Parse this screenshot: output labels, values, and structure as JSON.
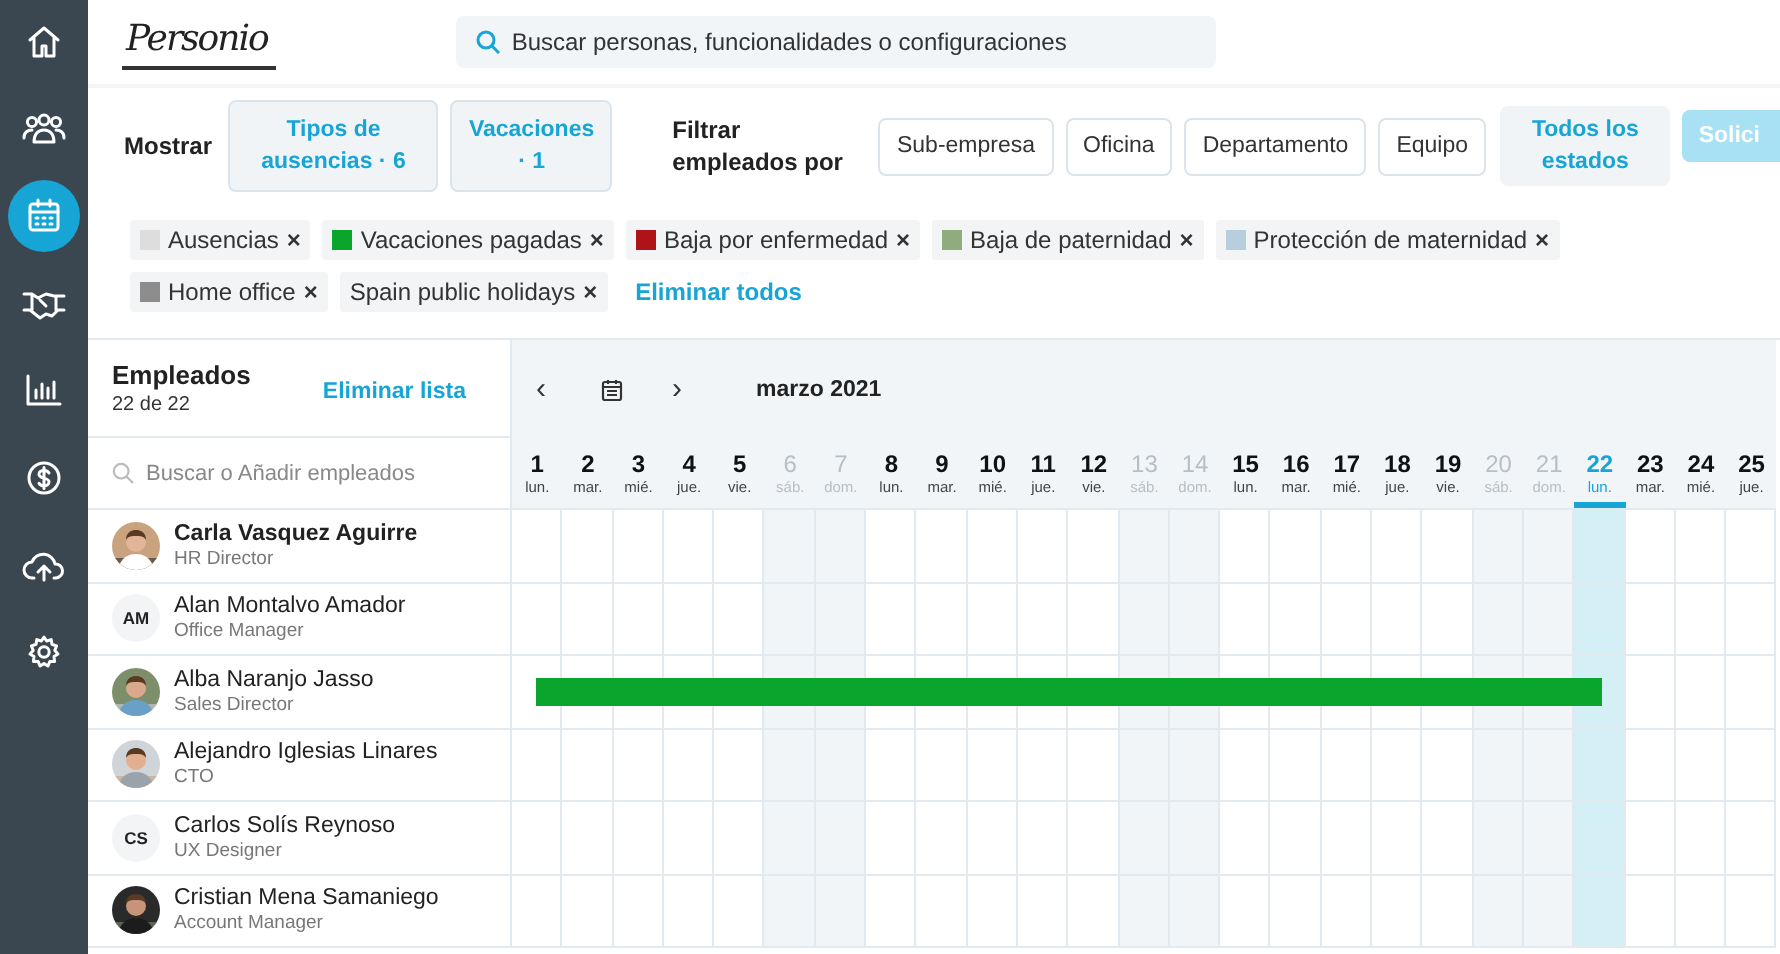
{
  "sidebar": {
    "items": [
      {
        "kind": "home",
        "selected": false
      },
      {
        "kind": "people",
        "selected": false
      },
      {
        "kind": "calendar",
        "selected": true
      },
      {
        "kind": "handshake",
        "selected": false
      },
      {
        "kind": "chart",
        "selected": false
      },
      {
        "kind": "dollar",
        "selected": false
      },
      {
        "kind": "cloud",
        "selected": false
      },
      {
        "kind": "gear",
        "selected": false
      }
    ]
  },
  "header": {
    "logo": "Personio",
    "search": {
      "placeholder": "Buscar personas, funcionalidades o configuraciones"
    }
  },
  "filters": {
    "show_label": "Mostrar",
    "show_buttons": [
      "Tipos de ausencias · 6",
      "Vacaciones · 1"
    ],
    "filter_label": "Filtrar empleados por",
    "filter_buttons": [
      "Sub-empresa",
      "Oficina",
      "Departamento",
      "Equipo"
    ],
    "status_button": "Todos los estados",
    "request_button": "Solici"
  },
  "tags": {
    "items": [
      {
        "label": "Ausencias",
        "color": "#dddddd"
      },
      {
        "label": "Vacaciones pagadas",
        "color": "#0aa52c"
      },
      {
        "label": "Baja por enfermedad",
        "color": "#b0121a"
      },
      {
        "label": "Baja de paternidad",
        "color": "#8fac7c"
      },
      {
        "label": "Protección de maternidad",
        "color": "#b7cfdc"
      },
      {
        "label": "Home office",
        "color": "#8d8d8d"
      },
      {
        "label": "Spain public holidays"
      }
    ],
    "remove_symbol": "×",
    "clear_all": "Eliminar todos"
  },
  "employees": {
    "title": "Empleados",
    "count": "22 de 22",
    "clear_list": "Eliminar lista",
    "search": {
      "placeholder": "Buscar o Añadir empleados"
    },
    "rows": [
      {
        "name": "Carla Vasquez Aguirre",
        "role": "HR Director",
        "selected": true
      },
      {
        "name": "Alan Montalvo Amador",
        "role": "Office Manager",
        "avatar": {
          "kind": "initials",
          "text": "AM"
        },
        "selected": false
      },
      {
        "name": "Alba Naranjo Jasso",
        "role": "Sales Director",
        "selected": false,
        "absence": {
          "color": "#0aa52c",
          "days": [
            true,
            true,
            true,
            true,
            true,
            true,
            true,
            true,
            true,
            true,
            true,
            true,
            true,
            true,
            true,
            true,
            true,
            true,
            true,
            true,
            true,
            true,
            false,
            false,
            false
          ]
        }
      },
      {
        "name": "Alejandro Iglesias Linares",
        "role": "CTO",
        "selected": false
      },
      {
        "name": "Carlos Solís Reynoso",
        "role": "UX Designer",
        "avatar": {
          "kind": "initials",
          "text": "CS"
        },
        "selected": false
      },
      {
        "name": "Cristian Mena Samaniego",
        "role": "Account Manager",
        "selected": false
      }
    ]
  },
  "calendar": {
    "prev": "‹",
    "next": "›",
    "month": "marzo 2021",
    "days": [
      {
        "day": "1",
        "weekday": "lun.",
        "weekend": false,
        "selected": false
      },
      {
        "day": "2",
        "weekday": "mar.",
        "weekend": false,
        "selected": false
      },
      {
        "day": "3",
        "weekday": "mié.",
        "weekend": false,
        "selected": false
      },
      {
        "day": "4",
        "weekday": "jue.",
        "weekend": false,
        "selected": false
      },
      {
        "day": "5",
        "weekday": "vie.",
        "weekend": false,
        "selected": false
      },
      {
        "day": "6",
        "weekday": "sáb.",
        "weekend": true,
        "selected": false
      },
      {
        "day": "7",
        "weekday": "dom.",
        "weekend": true,
        "selected": false
      },
      {
        "day": "8",
        "weekday": "lun.",
        "weekend": false,
        "selected": false
      },
      {
        "day": "9",
        "weekday": "mar.",
        "weekend": false,
        "selected": false
      },
      {
        "day": "10",
        "weekday": "mié.",
        "weekend": false,
        "selected": false
      },
      {
        "day": "11",
        "weekday": "jue.",
        "weekend": false,
        "selected": false
      },
      {
        "day": "12",
        "weekday": "vie.",
        "weekend": false,
        "selected": false
      },
      {
        "day": "13",
        "weekday": "sáb.",
        "weekend": true,
        "selected": false
      },
      {
        "day": "14",
        "weekday": "dom.",
        "weekend": true,
        "selected": false
      },
      {
        "day": "15",
        "weekday": "lun.",
        "weekend": false,
        "selected": false
      },
      {
        "day": "16",
        "weekday": "mar.",
        "weekend": false,
        "selected": false
      },
      {
        "day": "17",
        "weekday": "mié.",
        "weekend": false,
        "selected": false
      },
      {
        "day": "18",
        "weekday": "jue.",
        "weekend": false,
        "selected": false
      },
      {
        "day": "19",
        "weekday": "vie.",
        "weekend": false,
        "selected": false
      },
      {
        "day": "20",
        "weekday": "sáb.",
        "weekend": true,
        "selected": false
      },
      {
        "day": "21",
        "weekday": "dom.",
        "weekend": true,
        "selected": false
      },
      {
        "day": "22",
        "weekday": "lun.",
        "weekend": false,
        "selected": true
      },
      {
        "day": "23",
        "weekday": "mar.",
        "weekend": false,
        "selected": false
      },
      {
        "day": "24",
        "weekday": "mié.",
        "weekend": false,
        "selected": false
      },
      {
        "day": "25",
        "weekday": "jue.",
        "weekend": false,
        "selected": false
      }
    ]
  }
}
